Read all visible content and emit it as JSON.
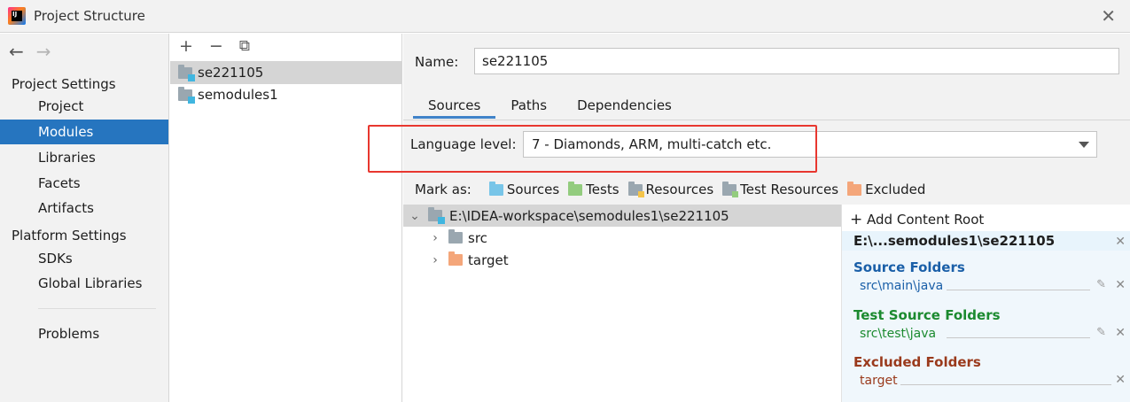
{
  "window": {
    "title": "Project Structure",
    "logo_text": "IJ"
  },
  "nav": {
    "back": "←",
    "forward": "→",
    "project_settings": "Project Settings",
    "platform_settings": "Platform Settings",
    "items": [
      "Project",
      "Modules",
      "Libraries",
      "Facets",
      "Artifacts"
    ],
    "platform_items": [
      "SDKs",
      "Global Libraries"
    ],
    "problems": "Problems"
  },
  "modules": {
    "toolbar": {
      "add": "+",
      "remove": "−",
      "copy": "⧉"
    },
    "list": [
      "se221105",
      "semodules1"
    ]
  },
  "editor": {
    "name_label": "Name:",
    "name_value": "se221105",
    "tabs": [
      "Sources",
      "Paths",
      "Dependencies"
    ],
    "language_level_label": "Language level:",
    "language_level_value": "7 - Diamonds, ARM, multi-catch etc.",
    "mark_as_label": "Mark as:",
    "mark_as": {
      "sources": "Sources",
      "tests": "Tests",
      "resources": "Resources",
      "test_resources": "Test Resources",
      "excluded": "Excluded"
    }
  },
  "tree": {
    "root": "E:\\IDEA-workspace\\semodules1\\se221105",
    "children": [
      "src",
      "target"
    ]
  },
  "content_root": {
    "add_label": "Add Content Root",
    "path": "E:\\...semodules1\\se221105",
    "source_folders_title": "Source Folders",
    "source_folder": "src\\main\\java",
    "test_source_folders_title": "Test Source Folders",
    "test_source_folder": "src\\test\\java",
    "excluded_folders_title": "Excluded Folders",
    "excluded_folder": "target"
  },
  "colors": {
    "accent": "#2675bf",
    "highlight_box": "#e8372f",
    "source_title": "#1a5fa8",
    "test_title": "#1b8a2f",
    "excluded_title": "#9a3a1c"
  }
}
